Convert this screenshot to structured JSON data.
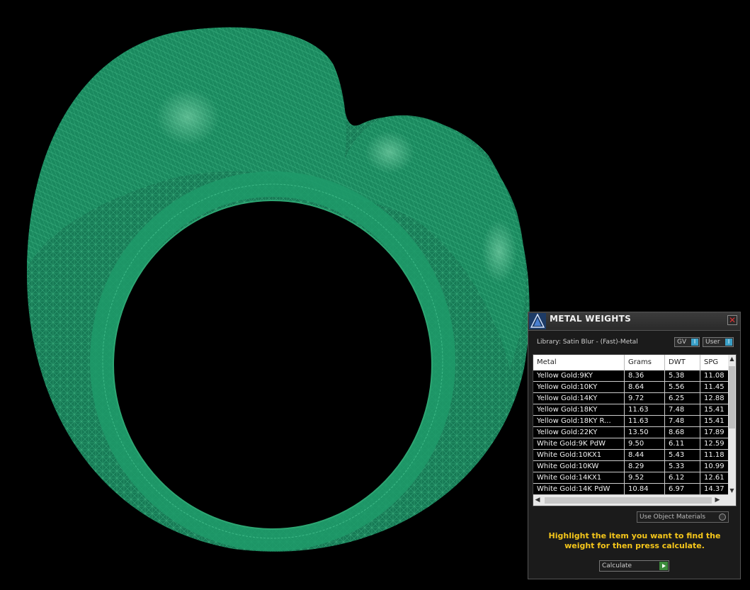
{
  "viewport": {
    "model": "ring-wireframe",
    "mesh_color": "#1e8a5e",
    "background": "#000000"
  },
  "panel": {
    "title": "METAL WEIGHTS",
    "close_icon": "close-icon",
    "app_icon": "app-icon",
    "library": "Library: Satin Blur - (Fast)-Metal",
    "toggle_gv": "GV",
    "toggle_user": "User",
    "toggle_knob": "I",
    "columns": [
      "Metal",
      "Grams",
      "DWT",
      "SPG"
    ],
    "rows": [
      [
        "Yellow Gold:9KY",
        "8.36",
        "5.38",
        "11.08"
      ],
      [
        "Yellow Gold:10KY",
        "8.64",
        "5.56",
        "11.45"
      ],
      [
        "Yellow Gold:14KY",
        "9.72",
        "6.25",
        "12.88"
      ],
      [
        "Yellow Gold:18KY",
        "11.63",
        "7.48",
        "15.41"
      ],
      [
        "Yellow Gold:18KY R...",
        "11.63",
        "7.48",
        "15.41"
      ],
      [
        "Yellow Gold:22KY",
        "13.50",
        "8.68",
        "17.89"
      ],
      [
        "White Gold:9K PdW",
        "9.50",
        "6.11",
        "12.59"
      ],
      [
        "White Gold:10KX1",
        "8.44",
        "5.43",
        "11.18"
      ],
      [
        "White Gold:10KW",
        "8.29",
        "5.33",
        "10.99"
      ],
      [
        "White Gold:14KX1",
        "9.52",
        "6.12",
        "12.61"
      ],
      [
        "White Gold:14K PdW",
        "10.84",
        "6.97",
        "14.37"
      ]
    ],
    "use_object_materials": "Use Object Materials",
    "instructions": "Highlight the item you want to find the weight for then press calculate.",
    "calculate": "Calculate",
    "accent_color": "#f5c61a"
  }
}
